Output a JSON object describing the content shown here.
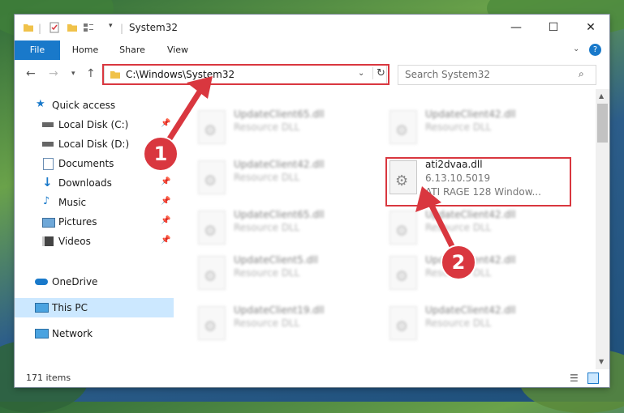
{
  "window": {
    "title": "System32",
    "minimize": "—",
    "maximize": "☐",
    "close": "✕"
  },
  "ribbon": {
    "tabs": [
      "File",
      "Home",
      "Share",
      "View"
    ],
    "help": "?"
  },
  "nav": {
    "address": "C:\\Windows\\System32",
    "search_placeholder": "Search System32"
  },
  "sidebar": {
    "items": [
      {
        "label": "Quick access",
        "icon": "star-icon"
      },
      {
        "label": "Local Disk (C:)",
        "icon": "drive-icon"
      },
      {
        "label": "Local Disk (D:)",
        "icon": "drive-icon"
      },
      {
        "label": "Documents",
        "icon": "documents-icon"
      },
      {
        "label": "Downloads",
        "icon": "download-icon"
      },
      {
        "label": "Music",
        "icon": "music-icon"
      },
      {
        "label": "Pictures",
        "icon": "pictures-icon"
      },
      {
        "label": "Videos",
        "icon": "videos-icon"
      },
      {
        "label": "OneDrive",
        "icon": "cloud-icon"
      },
      {
        "label": "This PC",
        "icon": "computer-icon"
      },
      {
        "label": "Network",
        "icon": "network-icon"
      }
    ]
  },
  "files": [
    {
      "name": "UpdateClient65.dll",
      "sub": "Resource DLL"
    },
    {
      "name": "UpdateClient42.dll",
      "sub": "Resource DLL"
    },
    {
      "name": "UpdateClient42.dll",
      "sub": "Resource DLL"
    },
    {
      "name": "ati2dvaa.dll",
      "version": "6.13.10.5019",
      "desc": "ATI RAGE 128 Window..."
    },
    {
      "name": "UpdateClient65.dll",
      "sub": "Resource DLL"
    },
    {
      "name": "UpdateClient42.dll",
      "sub": "Resource DLL"
    },
    {
      "name": "UpdateClient5.dll",
      "sub": "Resource DLL"
    },
    {
      "name": "UpdateClient42.dll",
      "sub": "Resource DLL"
    },
    {
      "name": "UpdateClient19.dll",
      "sub": "Resource DLL"
    },
    {
      "name": "UpdateClient42.dll",
      "sub": "Resource DLL"
    }
  ],
  "status": {
    "count": "171 items"
  },
  "callouts": [
    "1",
    "2"
  ],
  "colors": {
    "accent": "#1979ca",
    "highlight": "#d9373f",
    "selected": "#cce8ff"
  }
}
